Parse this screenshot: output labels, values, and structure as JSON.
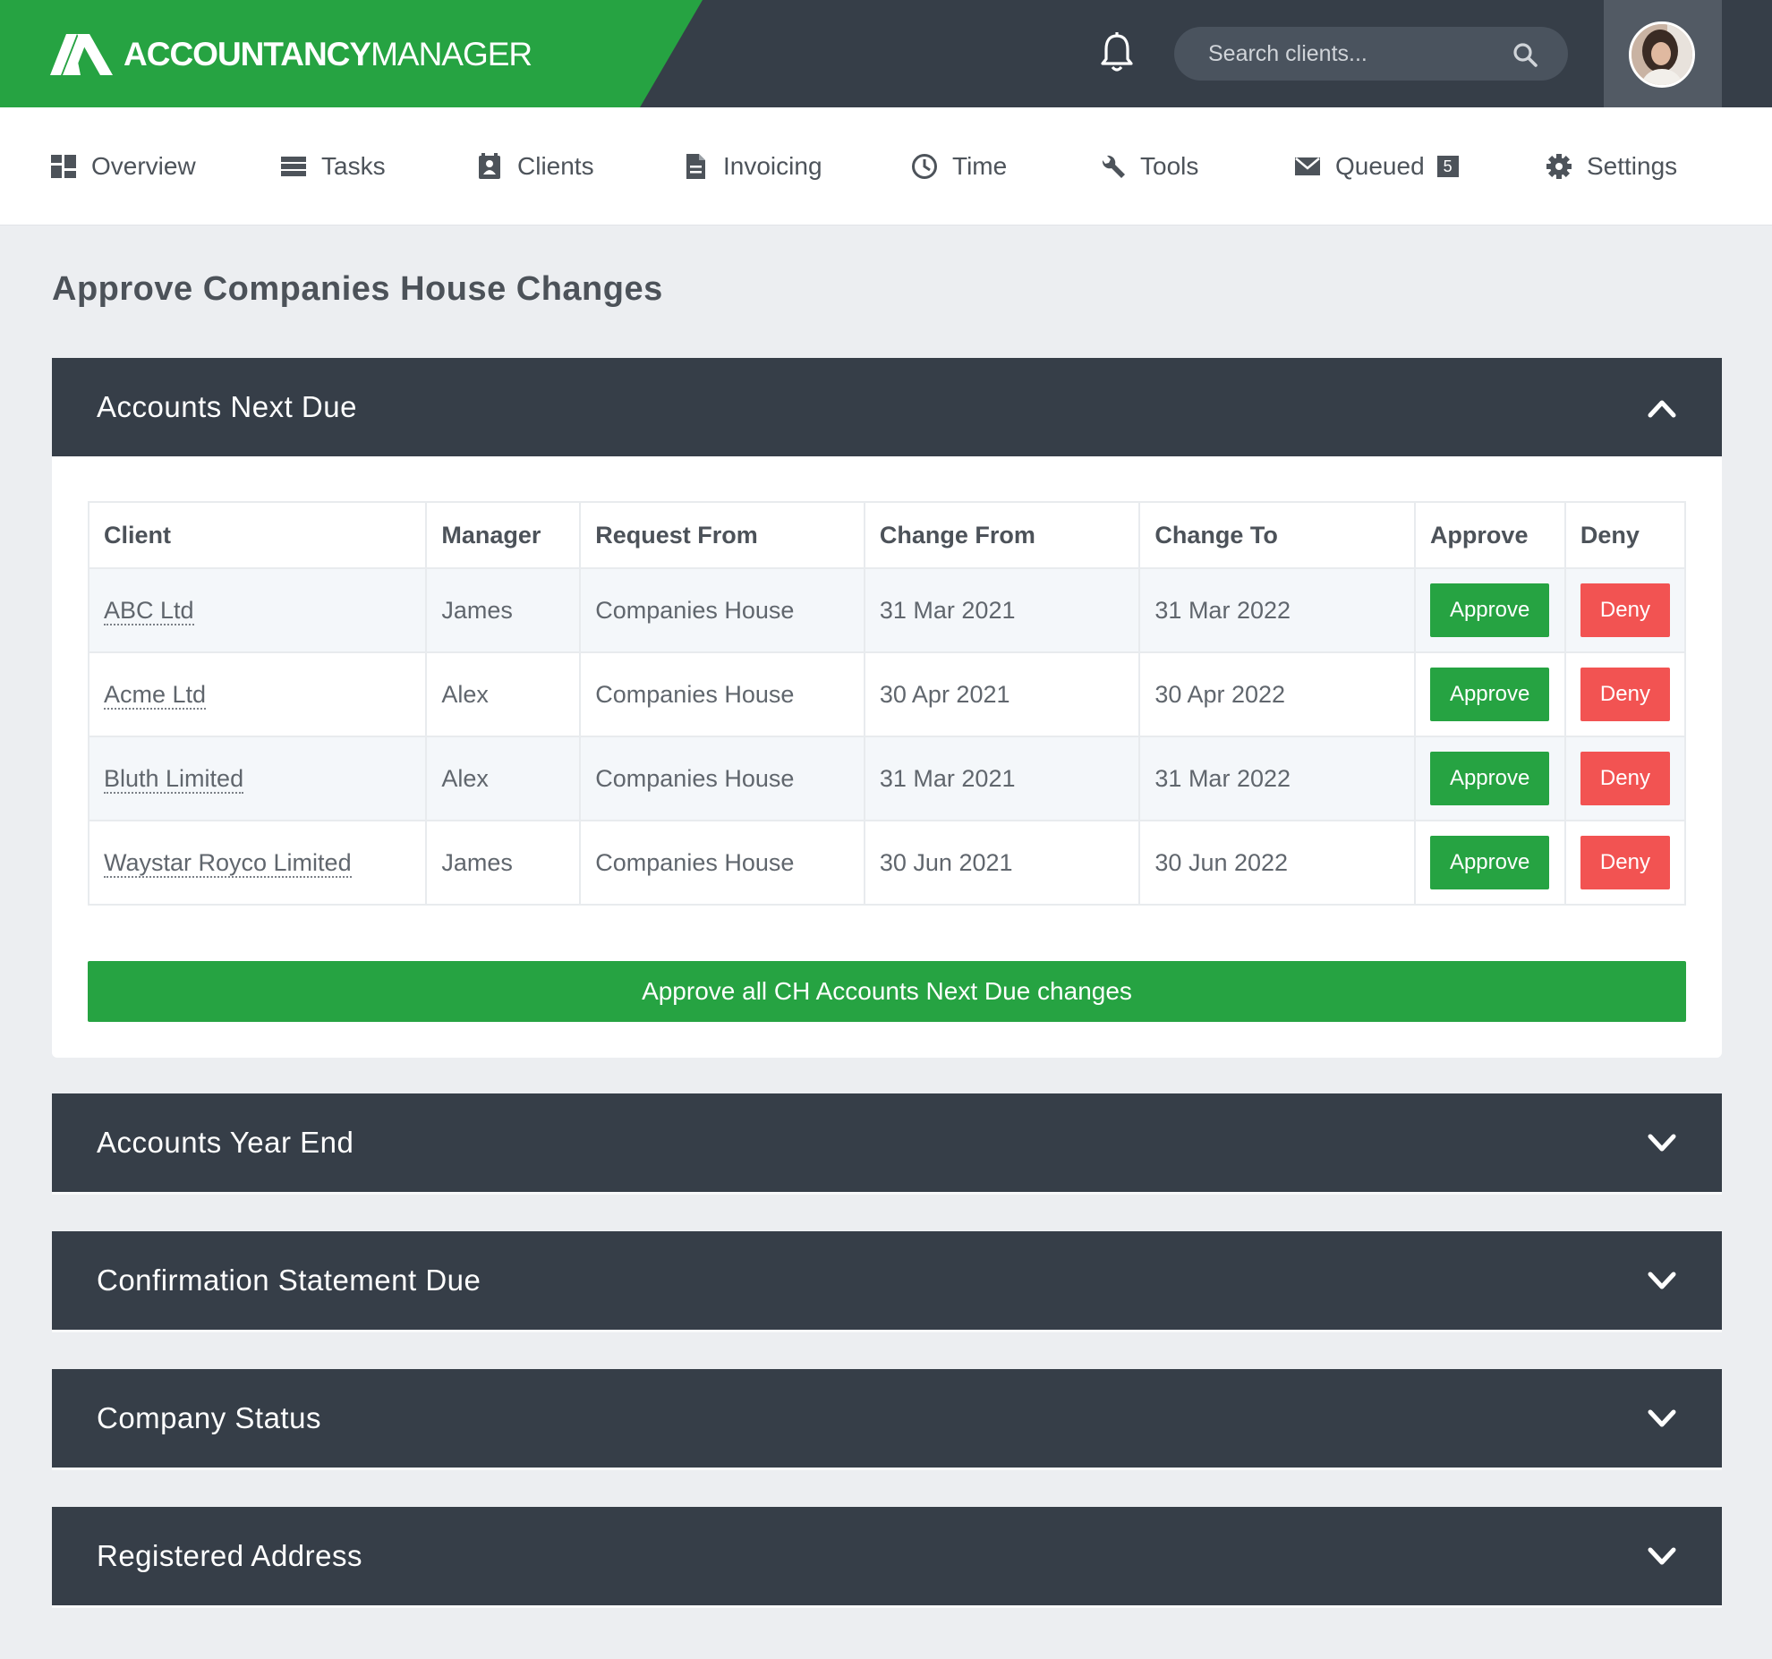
{
  "brand": {
    "name_bold": "ACCOUNTANCY",
    "name_light": "MANAGER"
  },
  "search": {
    "placeholder": "Search clients..."
  },
  "nav": [
    {
      "label": "Overview",
      "icon": "grid-icon"
    },
    {
      "label": "Tasks",
      "icon": "list-icon"
    },
    {
      "label": "Clients",
      "icon": "contact-icon"
    },
    {
      "label": "Invoicing",
      "icon": "document-icon"
    },
    {
      "label": "Time",
      "icon": "clock-icon"
    },
    {
      "label": "Tools",
      "icon": "wrench-icon"
    },
    {
      "label": "Queued",
      "icon": "envelope-icon",
      "badge": "5"
    },
    {
      "label": "Settings",
      "icon": "gear-icon"
    }
  ],
  "page_title": "Approve Companies House Changes",
  "panels": [
    {
      "title": "Accounts Next Due",
      "expanded": true
    },
    {
      "title": "Accounts Year End",
      "expanded": false
    },
    {
      "title": "Confirmation Statement Due",
      "expanded": false
    },
    {
      "title": "Company Status",
      "expanded": false
    },
    {
      "title": "Registered Address",
      "expanded": false
    }
  ],
  "table": {
    "headers": [
      "Client",
      "Manager",
      "Request From",
      "Change From",
      "Change To",
      "Approve",
      "Deny"
    ],
    "rows": [
      {
        "client": "ABC Ltd",
        "manager": "James",
        "request_from": "Companies House",
        "change_from": "31 Mar 2021",
        "change_to": "31 Mar 2022"
      },
      {
        "client": "Acme Ltd",
        "manager": "Alex",
        "request_from": "Companies House",
        "change_from": "30 Apr 2021",
        "change_to": "30 Apr 2022"
      },
      {
        "client": "Bluth Limited",
        "manager": "Alex",
        "request_from": "Companies House",
        "change_from": "31 Mar 2021",
        "change_to": "31 Mar 2022"
      },
      {
        "client": "Waystar Royco Limited",
        "manager": "James",
        "request_from": "Companies House",
        "change_from": "30 Jun 2021",
        "change_to": "30 Jun 2022"
      }
    ],
    "approve_label": "Approve",
    "deny_label": "Deny"
  },
  "approve_all_label": "Approve all CH Accounts Next Due changes",
  "colors": {
    "brand_green": "#26a342",
    "dark": "#363e48",
    "deny_red": "#f25352"
  }
}
